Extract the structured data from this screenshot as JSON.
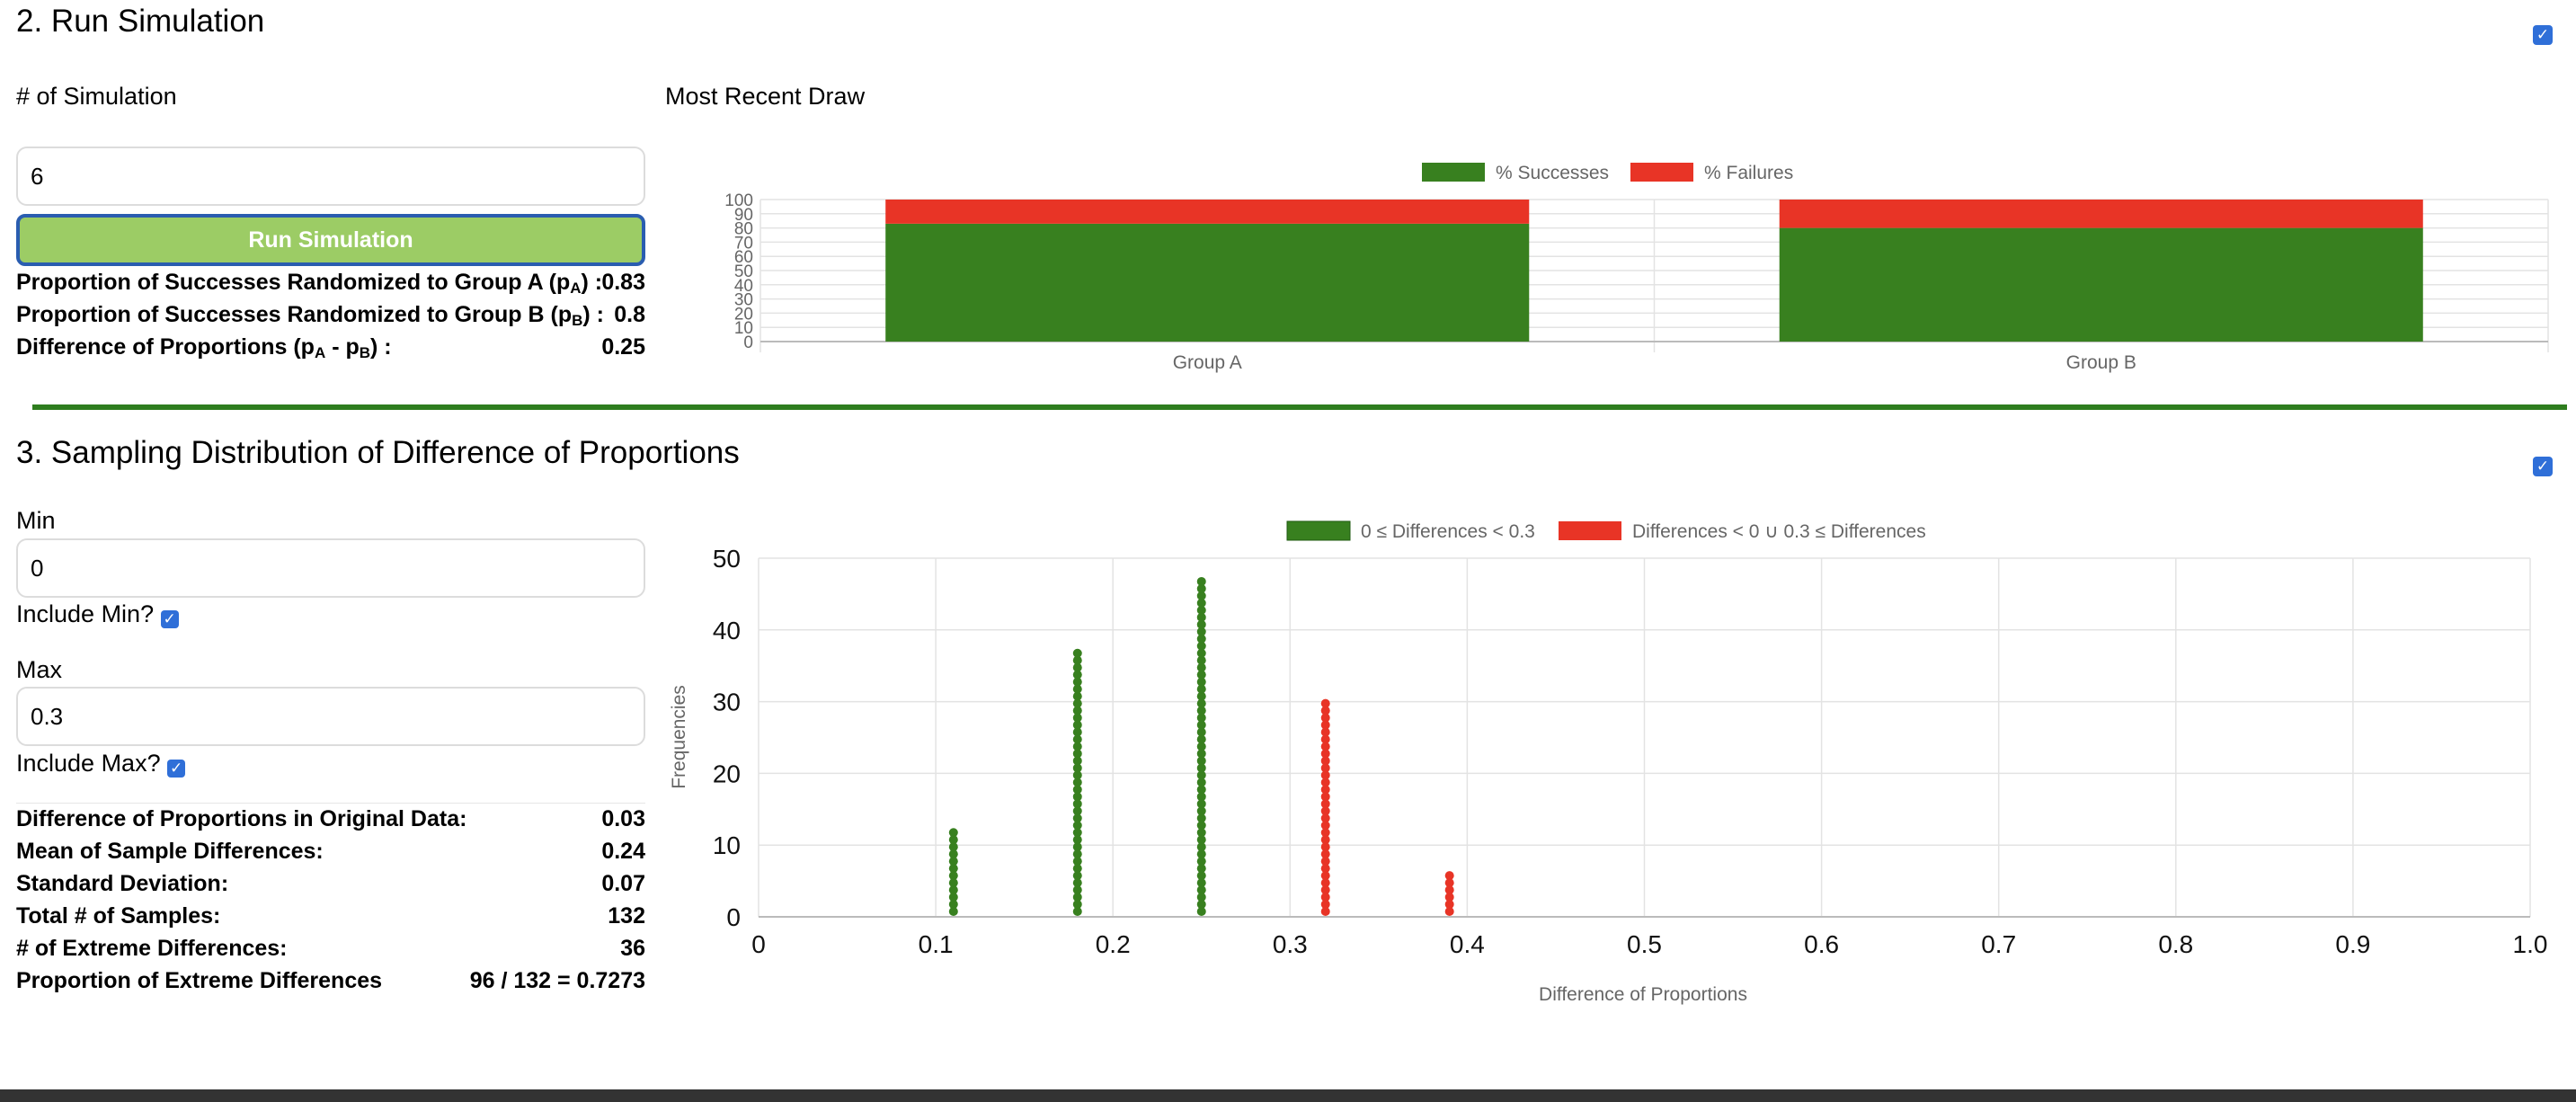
{
  "section2": {
    "title": "2. Run Simulation",
    "num_sim_label": "# of Simulation",
    "num_sim_value": "6",
    "run_button": "Run Simulation",
    "recent_draw_label": "Most Recent Draw",
    "stats": {
      "propA_label": "Proportion of Successes Randomized to Group A (p",
      "propA_sub": "A",
      "propA_tail": ") :",
      "propA_value": "0.83",
      "propB_label": "Proportion of Successes Randomized to Group B (p",
      "propB_sub": "B",
      "propB_tail": ") :",
      "propB_value": "0.8",
      "diff_label_1": "Difference of Proportions (p",
      "diff_sub_a": "A",
      "diff_mid": " - p",
      "diff_sub_b": "B",
      "diff_tail": ") :",
      "diff_value": "0.25"
    }
  },
  "section3": {
    "title": "3. Sampling Distribution of Difference of Proportions",
    "min_label": "Min",
    "min_value": "0",
    "include_min_label": "Include Min?",
    "max_label": "Max",
    "max_value": "0.3",
    "include_max_label": "Include Max?",
    "stats": [
      {
        "label": "Difference of Proportions in Original Data:",
        "value": "0.03"
      },
      {
        "label": "Mean of Sample Differences:",
        "value": "0.24"
      },
      {
        "label": "Standard Deviation:",
        "value": "0.07"
      },
      {
        "label": "Total # of Samples:",
        "value": "132"
      },
      {
        "label": "# of Extreme Differences:",
        "value": "36"
      },
      {
        "label": "Proportion of Extreme Differences",
        "value": "96 / 132 = 0.7273"
      }
    ]
  },
  "chart_data": [
    {
      "type": "bar",
      "stacked": true,
      "categories": [
        "Group A",
        "Group B"
      ],
      "series": [
        {
          "name": "% Successes",
          "values": [
            83,
            80
          ],
          "color": "#38801f"
        },
        {
          "name": "% Failures",
          "values": [
            17,
            20
          ],
          "color": "#e83426"
        }
      ],
      "y_ticks": [
        "0",
        "10",
        "20",
        "30",
        "40",
        "50",
        "60",
        "70",
        "80",
        "90",
        "100"
      ],
      "ylim": [
        0,
        100
      ],
      "legend": "top",
      "grid": true
    },
    {
      "type": "scatter",
      "subtype": "dotplot",
      "series": [
        {
          "name": "0 ≤ Differences < 0.3",
          "color": "#38801f",
          "points": [
            [
              0.11,
              12
            ],
            [
              0.18,
              37
            ],
            [
              0.25,
              47
            ]
          ]
        },
        {
          "name": "Differences < 0 ∪ 0.3 ≤ Differences",
          "color": "#e83426",
          "points": [
            [
              0.32,
              30
            ],
            [
              0.39,
              6
            ]
          ]
        }
      ],
      "xlabel": "Difference of Proportions",
      "ylabel": "Frequencies",
      "xlim": [
        0,
        1
      ],
      "ylim": [
        0,
        50
      ],
      "x_ticks": [
        "0",
        "0.1",
        "0.2",
        "0.3",
        "0.4",
        "0.5",
        "0.6",
        "0.7",
        "0.8",
        "0.9",
        "1.0"
      ],
      "y_ticks": [
        "0",
        "10",
        "20",
        "30",
        "40",
        "50"
      ],
      "legend": "top",
      "grid": true
    }
  ]
}
